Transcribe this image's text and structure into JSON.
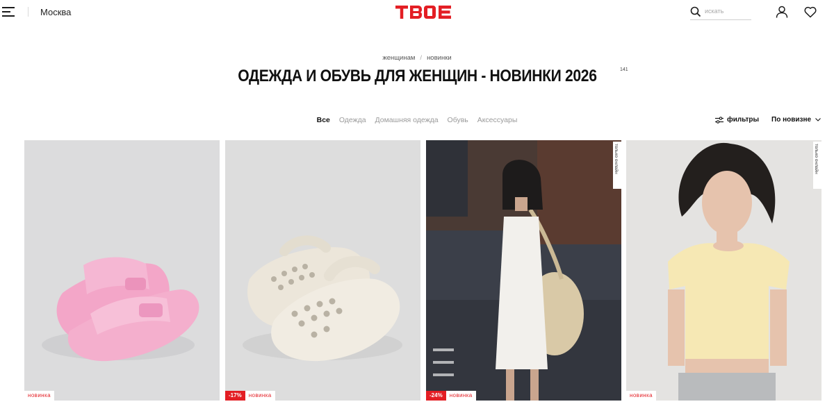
{
  "header": {
    "city": "Москва",
    "logo_text": "ТВОЕ",
    "search_placeholder": "искать",
    "brand_color": "#e31e24",
    "icons": [
      "menu-icon",
      "search-icon",
      "user-icon",
      "heart-icon"
    ]
  },
  "breadcrumb": {
    "items": [
      "женщинам",
      "новинки"
    ],
    "separator": "/"
  },
  "page": {
    "title": "ОДЕЖДА И ОБУВЬ ДЛЯ ЖЕНЩИН - НОВИНКИ 2026",
    "count": "141"
  },
  "categories": [
    {
      "label": "Все",
      "active": true
    },
    {
      "label": "Одежда",
      "active": false
    },
    {
      "label": "Домашняя одежда",
      "active": false
    },
    {
      "label": "Обувь",
      "active": false
    },
    {
      "label": "Аксессуары",
      "active": false
    }
  ],
  "toolbar": {
    "filters_label": "фильтры",
    "sort_label": "По новизне"
  },
  "products": [
    {
      "product": "pink sandals",
      "new_label": "новинка",
      "discount": "",
      "exclusive_label": ""
    },
    {
      "product": "white clogs",
      "new_label": "новинка",
      "discount": "-17%",
      "exclusive_label": ""
    },
    {
      "product": "white dress",
      "new_label": "новинка",
      "discount": "-24%",
      "exclusive_label": "только онлайн"
    },
    {
      "product": "yellow t-shirt",
      "new_label": "новинка",
      "discount": "",
      "exclusive_label": "только онлайн"
    }
  ]
}
